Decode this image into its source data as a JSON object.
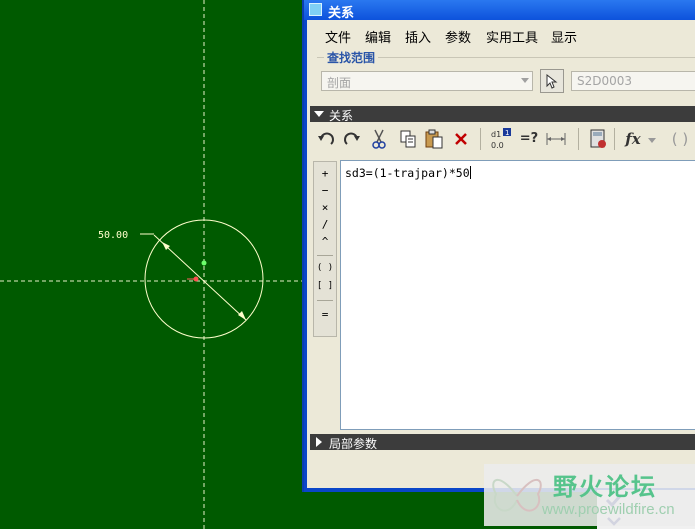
{
  "sketch": {
    "dimension_label": "50.00"
  },
  "dialog": {
    "title": "关系",
    "menu": [
      "文件",
      "编辑",
      "插入",
      "参数",
      "实用工具",
      "显示"
    ],
    "lookup_group_title": "查找范围",
    "lookup_scope_value": "剖面",
    "feature_field_value": "S2D0003",
    "relations_header": "关系",
    "local_params_header": "局部参数",
    "relation_text": "sd3=(1-trajpar)*50",
    "operators": [
      "+",
      "−",
      "×",
      "/",
      "^",
      "( )",
      "[ ]",
      "="
    ],
    "toolbar_icons": [
      "undo-icon",
      "redo-icon",
      "cut-icon",
      "copy-icon",
      "paste-icon",
      "delete-icon",
      "switch-dimensions-icon",
      "evaluate-icon",
      "measure-icon",
      "calculator-icon",
      "function-icon",
      "brackets-icon"
    ]
  },
  "watermark": {
    "title": "野火论坛",
    "url": "www.proewildfire.cn"
  },
  "colors": {
    "canvas_bg": "#005a00",
    "sketch_line": "#ffffcc",
    "dialog_title": "#0d52dc",
    "panel_bg": "#ece9d8"
  }
}
